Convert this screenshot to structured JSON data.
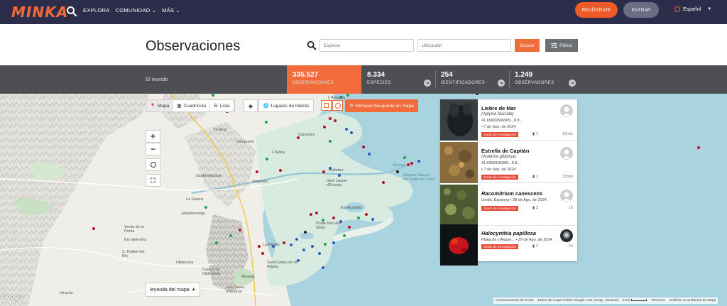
{
  "nav": {
    "logo": "MINKA",
    "links": [
      {
        "label": "EXPLORA"
      },
      {
        "label": "COMUNIDAD"
      },
      {
        "label": "MÁS"
      }
    ],
    "register_label": "REGÍSTRATE",
    "login_label": "ENTRAR",
    "language": "Español",
    "accent_color": "#f26b3a",
    "bg_color": "#2b2d4a"
  },
  "header": {
    "title": "Observaciones",
    "species_placeholder": "Especie",
    "location_placeholder": "Ubicación",
    "search_label": "Buscar",
    "filters_label": "Filtros"
  },
  "stats": {
    "region": "El mundo",
    "items": [
      {
        "value": "335.527",
        "label": "OBSERVACIONES"
      },
      {
        "value": "8.334",
        "label": "ESPECIES"
      },
      {
        "value": "254",
        "label": "IDENTIFICADORES"
      },
      {
        "value": "1.249",
        "label": "OBSERVADORES"
      }
    ]
  },
  "map": {
    "tabs": [
      {
        "label": "Mapa",
        "icon": "map-pin-icon"
      },
      {
        "label": "Cuadrícula",
        "icon": "grid-icon"
      },
      {
        "label": "Lista",
        "icon": "list-icon"
      }
    ],
    "places_label": "Lugares de interés",
    "redo_label": "Rehacer búsqueda en mapa",
    "zoom_in": "+",
    "zoom_out": "−",
    "legend_label": "leyenda del mapa",
    "google": "Google",
    "attribution": {
      "shortcuts": "Combinaciones de teclas",
      "data": "Datos del mapa ©2024 Google, Inst. Geogr. Nacional",
      "scale": "2 km",
      "terms": "Términos",
      "report": "Notificar un problema de Maps"
    },
    "places": [
      {
        "name": "Camarles"
      },
      {
        "name": "Campredó"
      },
      {
        "name": "L'Aldea"
      },
      {
        "name": "Vinallop"
      },
      {
        "name": "Santa Bàrbara"
      },
      {
        "name": "Amposta"
      },
      {
        "name": "La Galera"
      },
      {
        "name": "Masdenverge"
      },
      {
        "name": "Deltebre"
      },
      {
        "name": "Sant Jaume d'Enveja"
      },
      {
        "name": "Els Muntells"
      },
      {
        "name": "Poble Nou del Delta"
      },
      {
        "name": "La Ràpita"
      },
      {
        "name": "Sant Carles de la Ràpita"
      },
      {
        "name": "Alcanar"
      },
      {
        "name": "Venta de la Punta"
      },
      {
        "name": "Els Valentins"
      },
      {
        "name": "S. Rafael del Río"
      },
      {
        "name": "Ulldecona"
      },
      {
        "name": "Castell de Ulldecona"
      },
      {
        "name": "Les Cases d'Alcanar"
      },
      {
        "name": "Vinaròs"
      },
      {
        "name": "Riumar"
      },
      {
        "name": "Parque Natural del Delta del Ebro"
      },
      {
        "name": "L'Ampolla"
      }
    ]
  },
  "observations": [
    {
      "name": "Liebre de Mar",
      "scientific": "(Aplysia fasciata)",
      "location": "41.69682666989...8.8...",
      "date": "• 7 de Sep. de 2024",
      "grade": "Grado de investigación",
      "count": "1",
      "time": "20min"
    },
    {
      "name": "Estrella de Capitán",
      "scientific": "(Asterina gibbosa)",
      "location": "41.6968196989...8.8...",
      "date": "• 7 de Sep. de 2024",
      "grade": "Grado de investigación",
      "count": "1",
      "time": "23min"
    },
    {
      "name": "Racomitrium canescens",
      "location": "Lleida, Espanya • 28 de Ago. de 2024",
      "grade": "Grado de investigación",
      "count": "2",
      "time": "1h"
    },
    {
      "name": "Halocynthia papillosa",
      "location": "Platja de s'Alquer... • 29 de Ago. de 2024",
      "grade": "Grado de investigación",
      "count": "1",
      "time": "1h"
    }
  ]
}
